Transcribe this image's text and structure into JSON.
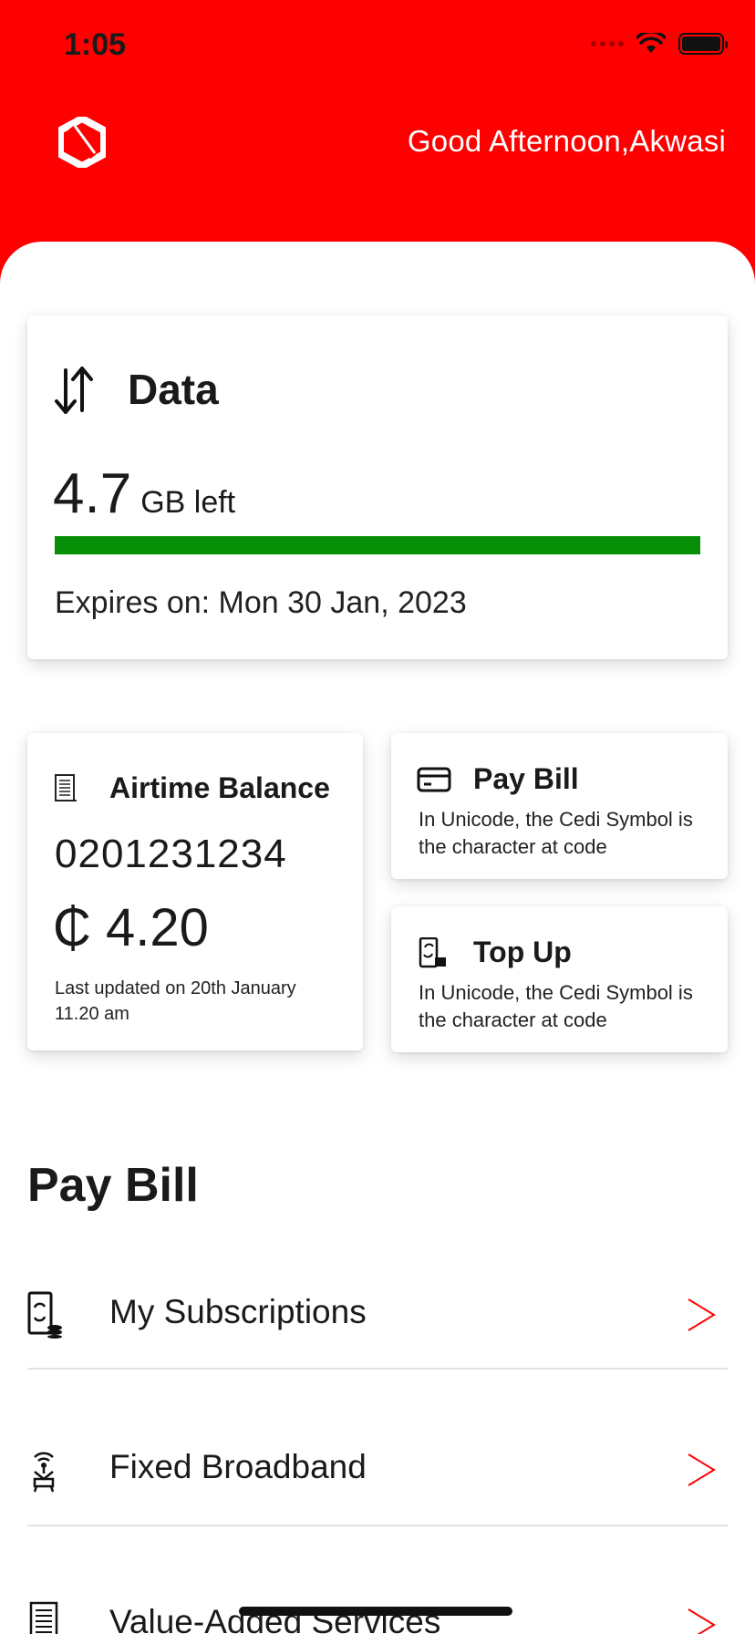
{
  "status_bar": {
    "time": "1:05"
  },
  "header": {
    "greeting": "Good Afternoon,Akwasi",
    "brand_color": "#fe0000"
  },
  "data_card": {
    "title": "Data",
    "amount": "4.7",
    "unit": "GB left",
    "progress_fraction": 1.0,
    "progress_color": "#068e06",
    "expires": "Expires on: Mon 30 Jan, 2023"
  },
  "airtime_card": {
    "title": "Airtime Balance",
    "phone": "0201231234",
    "balance": "₵ 4.20",
    "updated": "Last updated on 20th January 11.20 am"
  },
  "pay_bill_card": {
    "title": "Pay Bill",
    "description": "In Unicode, the Cedi Symbol is the character at code"
  },
  "top_up_card": {
    "title": "Top Up",
    "description": "In Unicode, the Cedi Symbol is the character at code"
  },
  "pay_bill_section": {
    "title": "Pay Bill",
    "items": [
      {
        "label": "My Subscriptions",
        "icon": "phone-subscription-icon"
      },
      {
        "label": "Fixed Broadband",
        "icon": "broadband-router-icon"
      },
      {
        "label": "Value-Added Services",
        "icon": "receipt-icon"
      }
    ]
  }
}
